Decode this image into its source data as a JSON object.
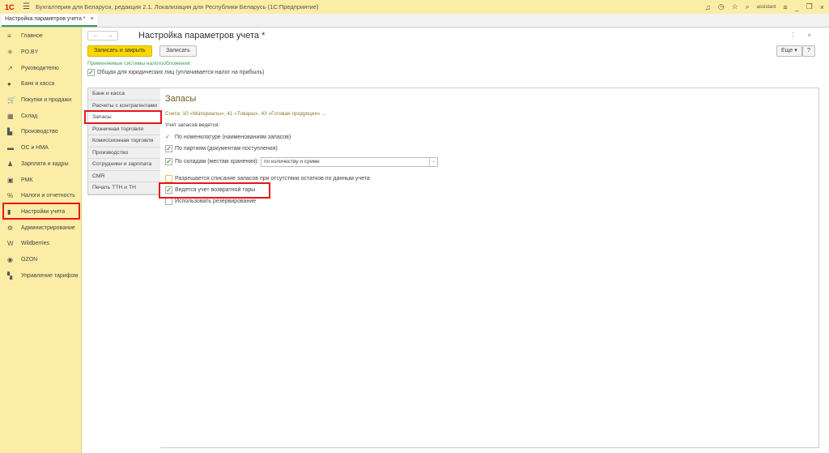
{
  "app": {
    "logo": "1С",
    "title": "Бухгалтерия для Беларуси, редакция 2.1. Локализация для Республики Беларусь  (1С:Предприятие)",
    "user": "assistant"
  },
  "tab": {
    "label": "Настройка параметров учета *",
    "close": "×"
  },
  "sidebar": {
    "items": [
      {
        "label": "Главное",
        "icon": "≡"
      },
      {
        "label": "PO.BY",
        "icon": "✳"
      },
      {
        "label": "Руководителю",
        "icon": "↗"
      },
      {
        "label": "Банк и касса",
        "icon": "●"
      },
      {
        "label": "Покупки и продажи",
        "icon": "🛒"
      },
      {
        "label": "Склад",
        "icon": "▦"
      },
      {
        "label": "Производство",
        "icon": "▙"
      },
      {
        "label": "ОС и НМА",
        "icon": "▬"
      },
      {
        "label": "Зарплата и кадры",
        "icon": "♟"
      },
      {
        "label": "РМК",
        "icon": "▣"
      },
      {
        "label": "Налоги и отчетность",
        "icon": "%"
      },
      {
        "label": "Настройки учета",
        "icon": "▮"
      },
      {
        "label": "Администрирование",
        "icon": "⚙"
      },
      {
        "label": "Wildberries",
        "icon": "W"
      },
      {
        "label": "OZON",
        "icon": "◉"
      },
      {
        "label": "Управление тарифом",
        "icon": "▚"
      }
    ]
  },
  "form": {
    "title": "Настройка параметров учета *",
    "save_close": "Записать и закрыть",
    "save": "Записать",
    "more": "Еще",
    "help": "?",
    "tax_label": "Применяемые системы налогообложения:",
    "tax_option": "Общая для юридических лиц (уплачивается налог на прибыль)"
  },
  "sections": [
    "Банк и касса",
    "Расчеты с контрагентами",
    "Запасы",
    "Розничная торговля",
    "Комиссионная торговля",
    "Производство",
    "Сотрудники и зарплата",
    "CMR",
    "Печать ТТН и ТН"
  ],
  "stock": {
    "title": "Запасы",
    "accounts": "Счета: 10 «Материалы», 41 «Товары», 43 «Готовая продукция» ...",
    "sub": "Учет запасов ведется:",
    "by_nomenclature": "По номенклатуре (наименованиям запасов)",
    "by_batches": "По партиям (документам поступления)",
    "by_warehouses": "По складам (местам хранения):",
    "warehouse_mode": "по количеству и сумме",
    "allow_writeoff": "Разрешается списание запасов при отсутствии остатков по данным учета",
    "returnable": "Ведется учет возвратной тары",
    "reservation": "Использовать резервирование"
  },
  "colors": {
    "accent": "#fbd700",
    "sidebar": "#fbeda5",
    "highlight": "#e8141b",
    "green": "#3a9a52"
  }
}
